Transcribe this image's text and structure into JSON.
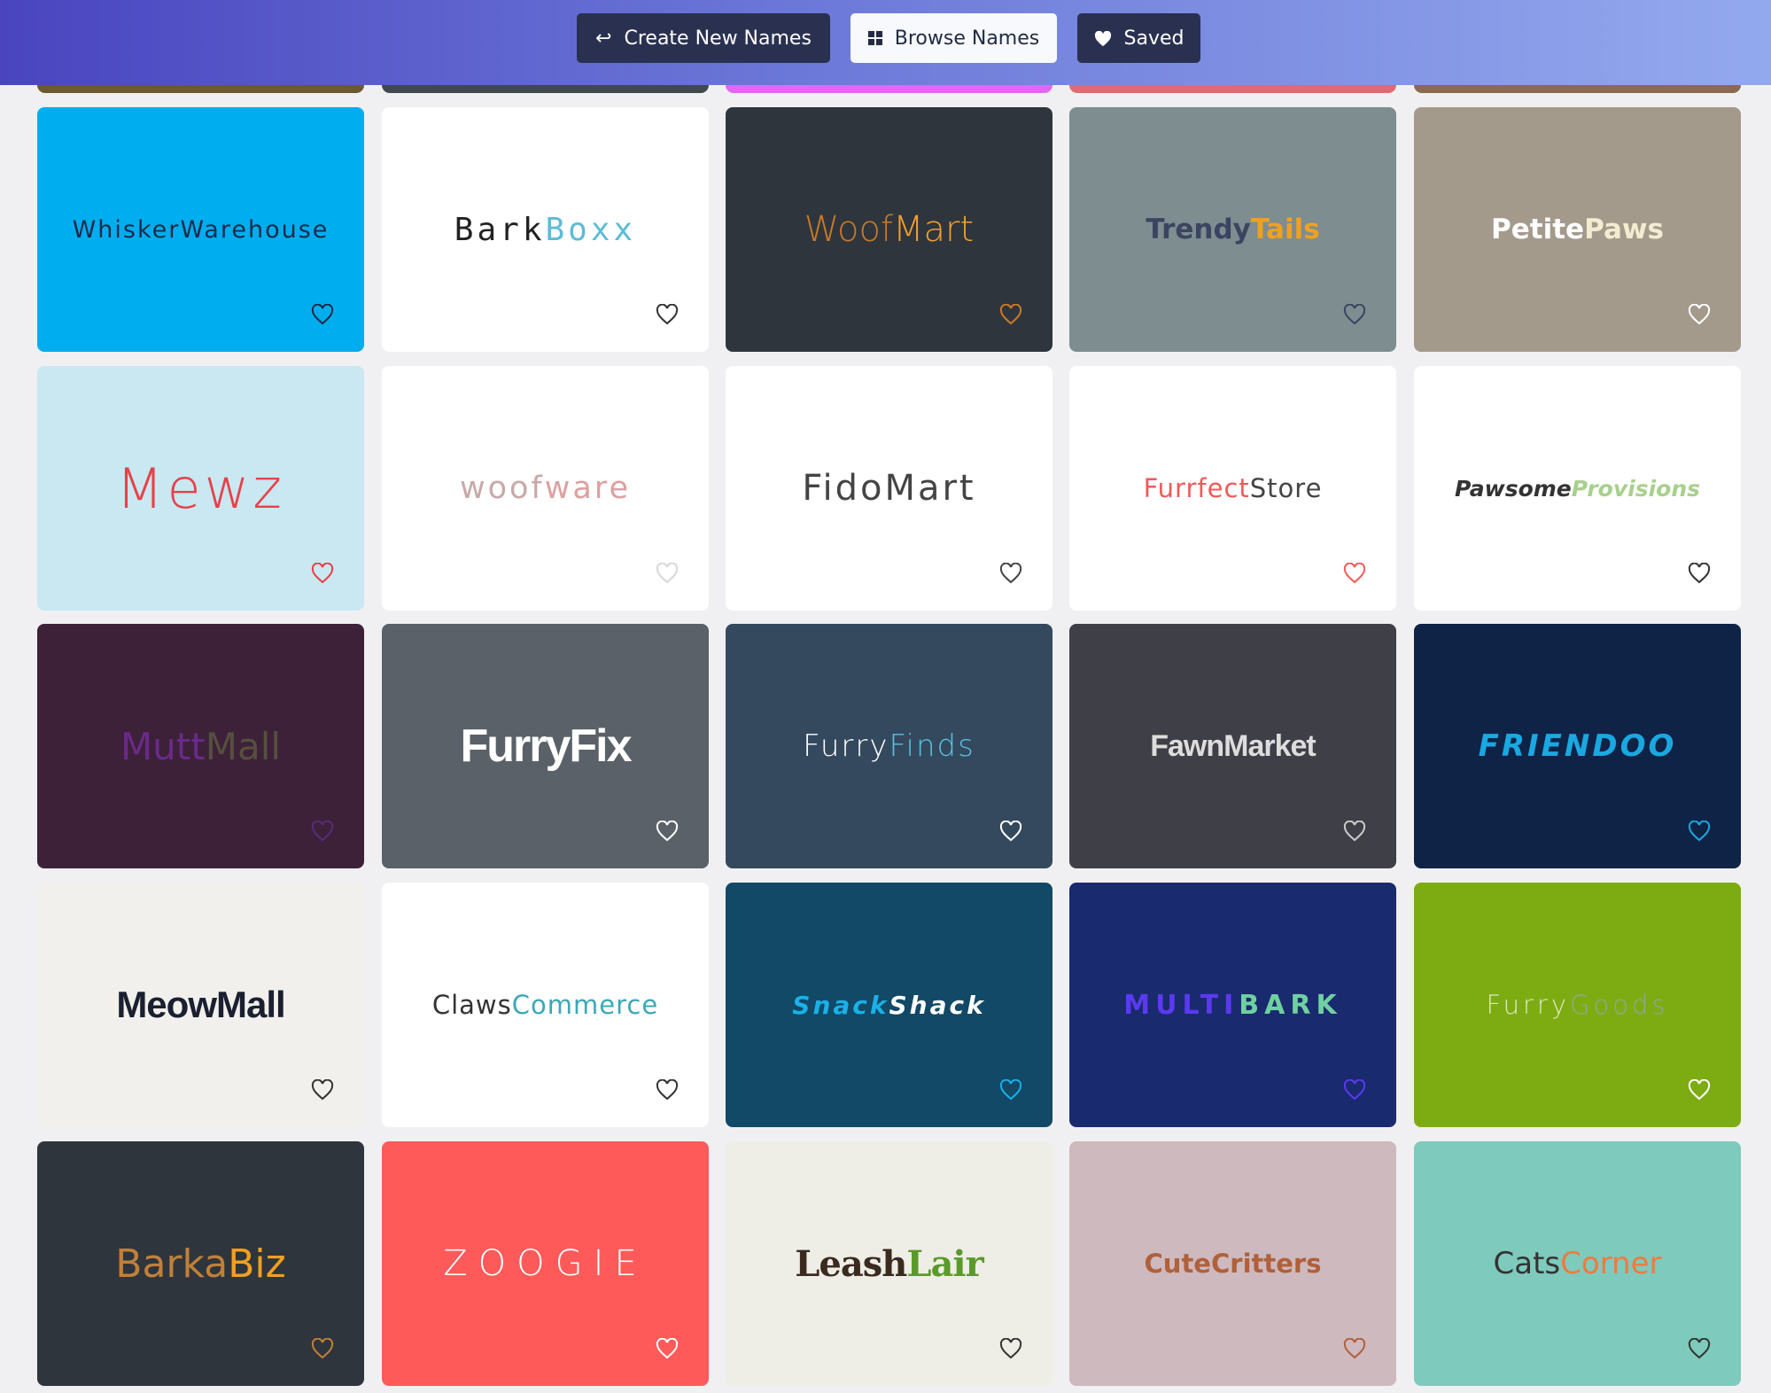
{
  "nav": {
    "create_label": "Create New Names",
    "create_icon": "return-arrow-icon",
    "browse_label": "Browse Names",
    "browse_icon": "grid-icon",
    "saved_label": "Saved",
    "saved_icon": "heart-filled-icon",
    "active": "Browse Names"
  },
  "partial_row_colors": [
    "#6b5a30",
    "#404850",
    "#e466f5",
    "#e06a72",
    "#8a6a50"
  ],
  "cards": [
    {
      "part1": "WhiskerWarehouse",
      "part2": "",
      "bg": "#00adee",
      "color1": "#1b2b4a",
      "color2": "#1b2b4a",
      "heart": "#1b2b4a"
    },
    {
      "part1": "Bark",
      "part2": "Boxx",
      "bg": "#ffffff",
      "color1": "#222222",
      "color2": "#5bbcd6",
      "heart": "#333333"
    },
    {
      "part1": "Woof",
      "part2": "Mart",
      "bg": "#2f353c",
      "color1": "#c77a2a",
      "color2": "#f0a030",
      "heart": "#c77a2a"
    },
    {
      "part1": "Trendy",
      "part2": "Tails",
      "bg": "#7d8d90",
      "color1": "#3b4460",
      "color2": "#f0a020",
      "heart": "#3b4460"
    },
    {
      "part1": "Petite",
      "part2": "Paws",
      "bg": "#a39a8c",
      "color1": "#ffffff",
      "color2": "#f3ecd0",
      "heart": "#ffffff"
    },
    {
      "part1": "Mewz",
      "part2": "",
      "bg": "#c9e8f1",
      "color1": "#e8404a",
      "color2": "#e8404a",
      "heart": "#e8404a"
    },
    {
      "part1": "woof",
      "part2": "ware",
      "bg": "#ffffff",
      "color1": "#c8a8a8",
      "color2": "#dca0a0",
      "heart": "#d8d8d8"
    },
    {
      "part1": "FidoMart",
      "part2": "",
      "bg": "#ffffff",
      "color1": "#444444",
      "color2": "#444444",
      "heart": "#444444"
    },
    {
      "part1": "Furrfect",
      "part2": "Store",
      "bg": "#ffffff",
      "color1": "#f05a5a",
      "color2": "#444444",
      "heart": "#f05a5a"
    },
    {
      "part1": "Pawsome",
      "part2": "Provisions",
      "bg": "#ffffff",
      "color1": "#333333",
      "color2": "#a8d08d",
      "heart": "#333333"
    },
    {
      "part1": "Mutt",
      "part2": "Mall",
      "bg": "#3d2139",
      "color1": "#6a2a8a",
      "color2": "#55503e",
      "heart": "#5a2a7a"
    },
    {
      "part1": "FurryFix",
      "part2": "",
      "bg": "#5a6168",
      "color1": "#ffffff",
      "color2": "#ffffff",
      "heart": "#ffffff"
    },
    {
      "part1": "Furry",
      "part2": "Finds",
      "bg": "#34495e",
      "color1": "#ffffff",
      "color2": "#5bc0de",
      "heart": "#ffffff"
    },
    {
      "part1": "FawnMarket",
      "part2": "",
      "bg": "#3f3f47",
      "color1": "#dddddd",
      "color2": "#dddddd",
      "heart": "#cccccc"
    },
    {
      "part1": "FRIENDOO",
      "part2": "",
      "bg": "#0f2347",
      "color1": "#1aa8e0",
      "color2": "#1aa8e0",
      "heart": "#1aa8e0"
    },
    {
      "part1": "MeowMall",
      "part2": "",
      "bg": "#f1f0ec",
      "color1": "#1a2030",
      "color2": "#1a2030",
      "heart": "#333333"
    },
    {
      "part1": "Claws",
      "part2": "Commerce",
      "bg": "#ffffff",
      "color1": "#333333",
      "color2": "#3aa8b8",
      "heart": "#333333"
    },
    {
      "part1": "Snack",
      "part2": "Shack",
      "bg": "#114966",
      "color1": "#1ab0e8",
      "color2": "#ffffff",
      "heart": "#1ab0e8"
    },
    {
      "part1": "MULTI",
      "part2": "BARK",
      "bg": "#1a2a6e",
      "color1": "#5a3af0",
      "color2": "#6fd0a0",
      "heart": "#5a3af0"
    },
    {
      "part1": "Furry",
      "part2": "Goods",
      "bg": "#7dac12",
      "color1": "#dde8c0",
      "color2": "#8fa89a",
      "heart": "#ffffff"
    },
    {
      "part1": "Barka",
      "part2": "Biz",
      "bg": "#2f353c",
      "color1": "#c0803a",
      "color2": "#f0a020",
      "heart": "#c0803a"
    },
    {
      "part1": "ZOOGIE",
      "part2": "",
      "bg": "#ff5a5a",
      "color1": "#ffffff",
      "color2": "#ffffff",
      "heart": "#ffffff"
    },
    {
      "part1": "Leash",
      "part2": "Lair",
      "bg": "#eeeee6",
      "color1": "#3a2a20",
      "color2": "#5a9a2a",
      "heart": "#333333"
    },
    {
      "part1": "Cute",
      "part2": "Critters",
      "bg": "#cdb9be",
      "color1": "#b0603a",
      "color2": "#b0603a",
      "heart": "#b0603a"
    },
    {
      "part1": "Cats",
      "part2": "Corner",
      "bg": "#7ecabc",
      "color1": "#333333",
      "color2": "#f07a40",
      "heart": "#333333"
    }
  ]
}
